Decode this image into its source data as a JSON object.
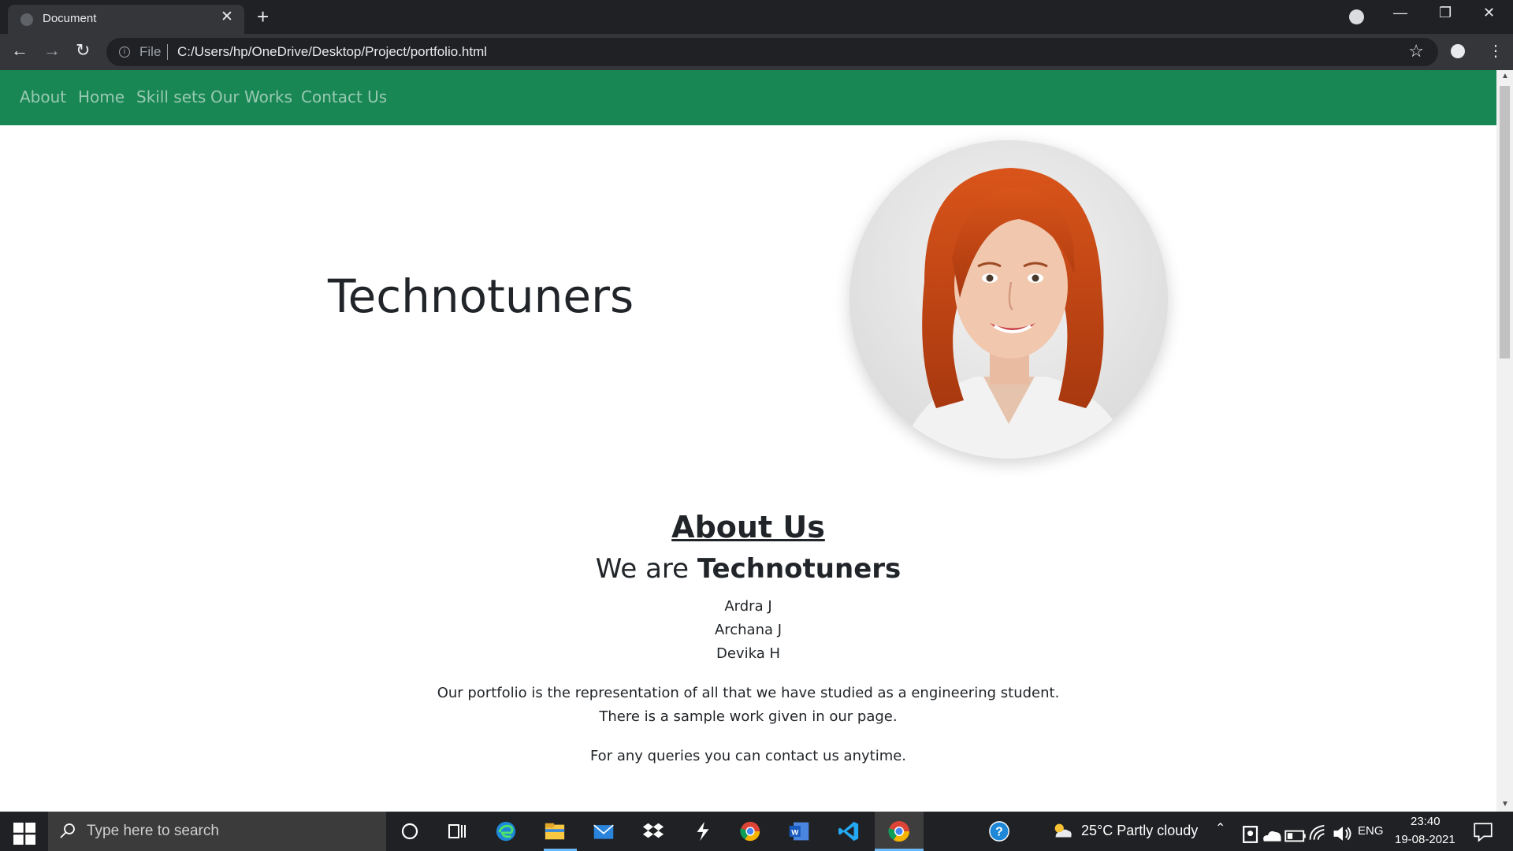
{
  "browser": {
    "tab_title": "Document",
    "tab_close": "✕",
    "new_tab": "+",
    "address_prefix": "File",
    "url": "C:/Users/hp/OneDrive/Desktop/Project/portfolio.html",
    "back": "←",
    "forward": "→",
    "reload": "↻",
    "star": "☆",
    "menu": "⋮",
    "minimize": "—",
    "restore": "❐",
    "close": "✕"
  },
  "navbar": {
    "links": [
      "About",
      "Home",
      "Skill sets",
      "Our Works",
      "Contact Us"
    ],
    "color": "#198754"
  },
  "hero": {
    "title": "Technotuners"
  },
  "about": {
    "heading": "About Us",
    "we_are_prefix": "We are ",
    "we_are_name": "Technotuners",
    "members": [
      "Ardra J",
      "Archana J",
      "Devika H"
    ],
    "paragraph_line1": "Our portfolio is the representation of all that we have studied as a engineering student.",
    "paragraph_line2": "There is a sample work given in our page.",
    "paragraph_contact": "For any queries you can contact us anytime."
  },
  "taskbar": {
    "search_placeholder": "Type here to search",
    "weather": "25°C  Partly cloudy",
    "language": "ENG",
    "time": "23:40",
    "date": "19-08-2021"
  }
}
